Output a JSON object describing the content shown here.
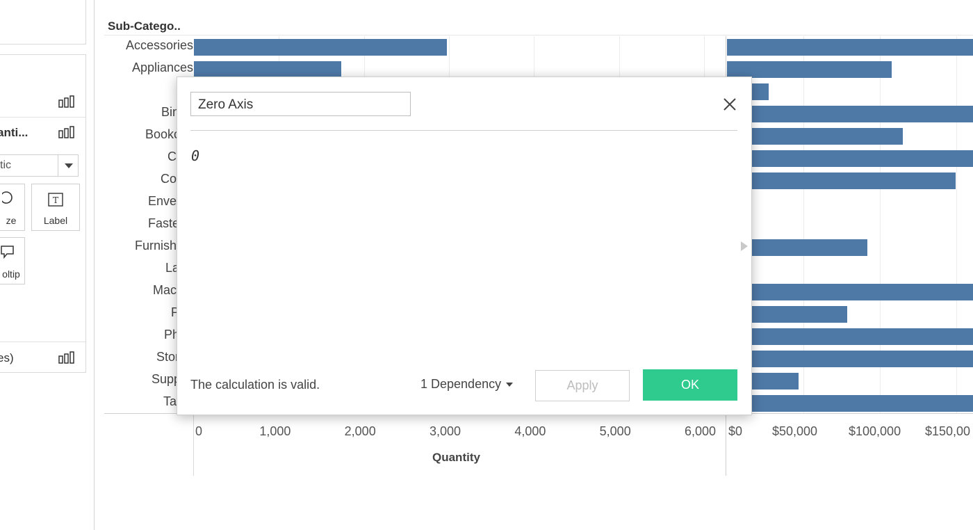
{
  "marks_panel": {
    "rows": [
      {
        "label": ""
      },
      {
        "label": "anti..."
      },
      {
        "label": "es)"
      }
    ],
    "mark_type": "tic",
    "cards": [
      {
        "label": "ze"
      },
      {
        "label": "Label"
      },
      {
        "label": "oltip"
      }
    ]
  },
  "chart": {
    "header": "Sub-Catego..",
    "categories": [
      "Accessories",
      "Appliances",
      "A",
      "Binde",
      "Bookcas",
      "Chai",
      "Copie",
      "Envelop",
      "Fastene",
      "Furnishing",
      "Labe",
      "Machin",
      "Pap",
      "Phon",
      "Storag",
      "Supplie",
      "Table"
    ],
    "quantity_ticks": [
      "0",
      "1,000",
      "2,000",
      "3,000",
      "4,000",
      "5,000",
      "6,000"
    ],
    "quantity_title": "Quantity",
    "sales_ticks": [
      "$0",
      "$50,000",
      "$100,000",
      "$150,00"
    ]
  },
  "chart_data": [
    {
      "type": "bar",
      "orientation": "horizontal",
      "categories": [
        "Accessories",
        "Appliances"
      ],
      "values": [
        2976,
        1729
      ],
      "xlabel": "Quantity",
      "xlim": [
        0,
        6000
      ]
    },
    {
      "type": "bar",
      "orientation": "horizontal",
      "categories": [
        "Accessories",
        "Appliances",
        "Art",
        "Binders",
        "Bookcases",
        "Chairs",
        "Copiers",
        "Envelopes",
        "Fasteners",
        "Furnishings",
        "Labels",
        "Machines",
        "Paper",
        "Phones",
        "Storage",
        "Supplies",
        "Tables"
      ],
      "values": [
        167380,
        107532,
        27119,
        203413,
        114880,
        328449,
        149528,
        16476,
        3024,
        91705,
        12486,
        189239,
        78479,
        330007,
        223844,
        46674,
        206966
      ],
      "xlim": [
        0,
        160000
      ]
    }
  ],
  "dialog": {
    "name": "Zero Axis",
    "formula": "0",
    "status": "The calculation is valid.",
    "dependency": "1 Dependency",
    "apply": "Apply",
    "ok": "OK"
  }
}
